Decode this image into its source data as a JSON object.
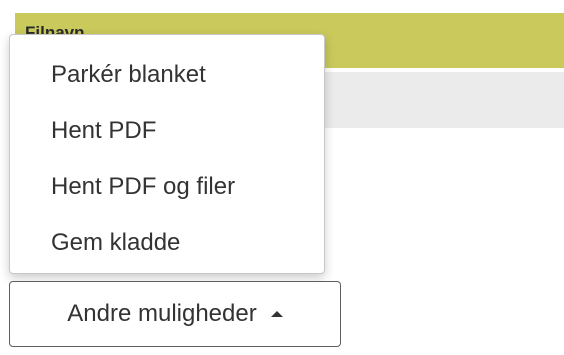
{
  "header": {
    "label": "Filnavn",
    "background": "#c9c95c"
  },
  "menu": {
    "items": [
      {
        "label": "Parkér blanket"
      },
      {
        "label": "Hent PDF"
      },
      {
        "label": "Hent PDF og filer"
      },
      {
        "label": "Gem kladde"
      }
    ]
  },
  "toggle": {
    "label": "Andre muligheder",
    "icon": "caret-up-icon"
  }
}
